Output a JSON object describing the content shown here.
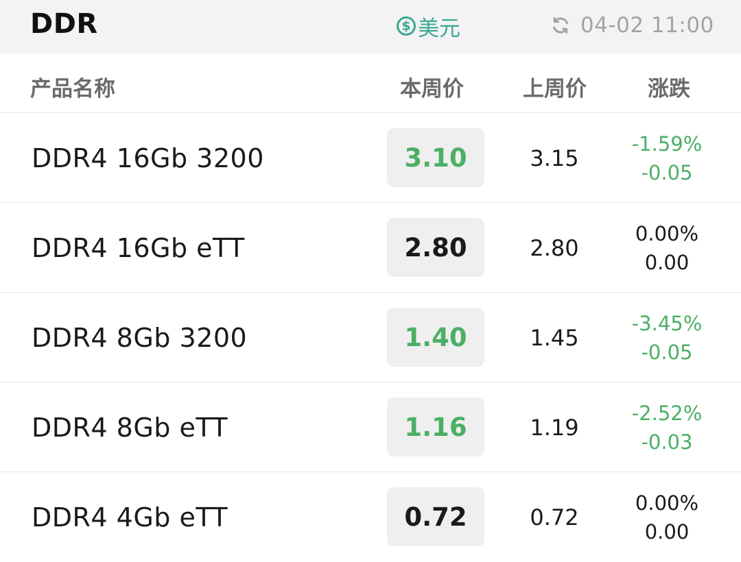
{
  "header": {
    "title": "DDR",
    "currency_symbol": "$",
    "currency_label": "美元",
    "updated_time": "04-02 11:00",
    "refresh_icon": "refresh-icon"
  },
  "table": {
    "columns": [
      "产品名称",
      "本周价",
      "上周价",
      "涨跌"
    ],
    "rows": [
      {
        "name": "DDR4 16Gb 3200",
        "this_week": "3.10",
        "last_week": "3.15",
        "change_pct": "-1.59%",
        "change_abs": "-0.05",
        "direction": "down"
      },
      {
        "name": "DDR4 16Gb eTT",
        "this_week": "2.80",
        "last_week": "2.80",
        "change_pct": "0.00%",
        "change_abs": "0.00",
        "direction": "flat"
      },
      {
        "name": "DDR4 8Gb 3200",
        "this_week": "1.40",
        "last_week": "1.45",
        "change_pct": "-3.45%",
        "change_abs": "-0.05",
        "direction": "down"
      },
      {
        "name": "DDR4 8Gb eTT",
        "this_week": "1.16",
        "last_week": "1.19",
        "change_pct": "-2.52%",
        "change_abs": "-0.03",
        "direction": "down"
      },
      {
        "name": "DDR4 4Gb eTT",
        "this_week": "0.72",
        "last_week": "0.72",
        "change_pct": "0.00%",
        "change_abs": "0.00",
        "direction": "flat"
      }
    ]
  },
  "colors": {
    "down": "#4caf66",
    "flat": "#1a1a1a",
    "accent": "#3aa893"
  }
}
